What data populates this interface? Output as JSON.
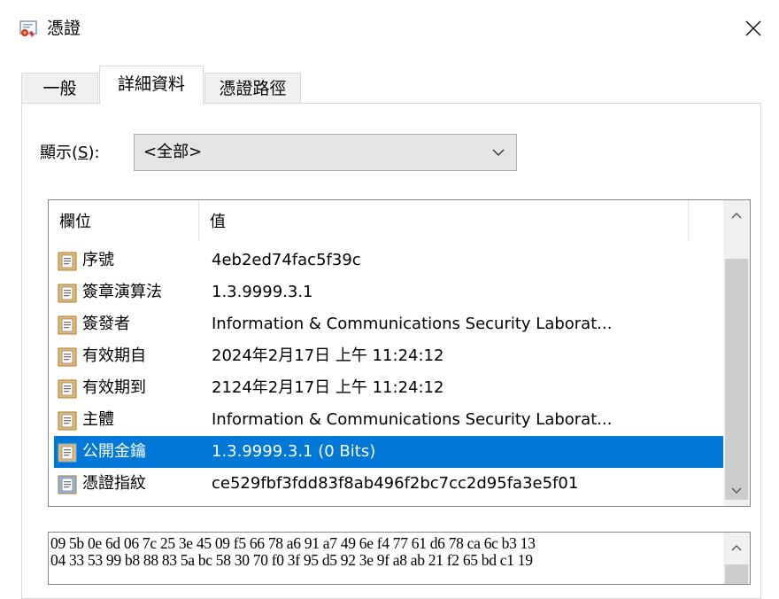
{
  "window": {
    "title": "憑證",
    "icon": "certificate-icon"
  },
  "tabs": [
    {
      "label": "一般",
      "active": false
    },
    {
      "label": "詳細資料",
      "active": true
    },
    {
      "label": "憑證路徑",
      "active": false
    }
  ],
  "show": {
    "label_prefix": "顯示(",
    "label_key": "S",
    "label_suffix": "):",
    "selected": "<全部>"
  },
  "list": {
    "columns": [
      "欄位",
      "值"
    ],
    "rows": [
      {
        "field": "序號",
        "value": "4eb2ed74fac5f39c",
        "icon": "field-icon",
        "selected": false
      },
      {
        "field": "簽章演算法",
        "value": "1.3.9999.3.1",
        "icon": "field-icon",
        "selected": false
      },
      {
        "field": "簽發者",
        "value": "Information & Communications Security Laborat...",
        "icon": "field-icon",
        "selected": false
      },
      {
        "field": "有效期自",
        "value": "2024年2月17日 上午 11:24:12",
        "icon": "field-icon",
        "selected": false
      },
      {
        "field": "有效期到",
        "value": "2124年2月17日 上午 11:24:12",
        "icon": "field-icon",
        "selected": false
      },
      {
        "field": "主體",
        "value": "Information & Communications Security Laborat...",
        "icon": "field-icon",
        "selected": false
      },
      {
        "field": "公開金鑰",
        "value": "1.3.9999.3.1 (0 Bits)",
        "icon": "field-icon",
        "selected": true
      },
      {
        "field": "憑證指紋",
        "value": "ce529fbf3fdd83f8ab496f2bc7cc2d95fa3e5f01",
        "icon": "property-icon",
        "selected": false
      }
    ]
  },
  "hex": {
    "lines": [
      "09 5b 0e 6d 06 7c 25 3e 45 09 f5 66 78 a6 91 a7 49 6e f4 77 61 d6 78 ca 6c b3 13",
      "04 33 53 99 b8 88 83 5a bc 58 30 70 f0 3f 95 d5 92 3e 9f a8 ab 21 f2 65 bd c1 19"
    ]
  },
  "colors": {
    "selection": "#0078d7",
    "field_icon": "#e8b86d",
    "property_icon": "#8fb5d8"
  }
}
